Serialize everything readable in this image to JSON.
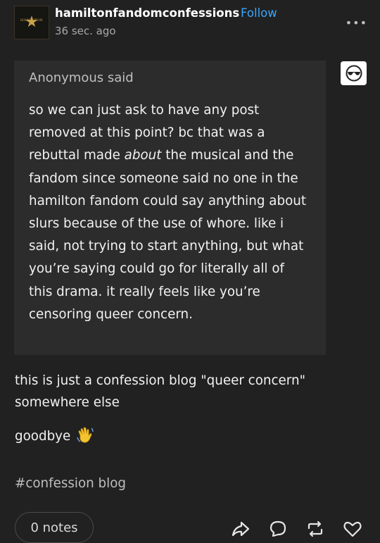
{
  "post": {
    "blog_name": "hamiltonfandomconfessions",
    "follow_label": "Follow",
    "timestamp": "36 sec. ago",
    "avatar_text": "HAMILTON",
    "ask": {
      "asker_name": "Anonymous",
      "asker_suffix": " said",
      "body_before": "so we can just ask to have any post removed at this point? bc that was a rebuttal made ",
      "body_emphasis": "about",
      "body_after": " the musical and the fandom since someone said no one in the hamilton fandom could say anything about slurs because of the use of whore. like i said, not trying to start anything, but what you’re saying could go for literally all of this drama. it really feels like you’re censoring queer concern."
    },
    "answer": "this is just a confession blog \"queer concern\" somewhere else",
    "goodbye": "goodbye",
    "tag": "#confession blog",
    "notes_label": "0 notes"
  },
  "colors": {
    "background": "#212121",
    "ask_background": "#2c2c2c",
    "follow_accent": "#3aa6ff",
    "muted_text": "#a8a8a8",
    "avatar_gold": "#c9a24a"
  },
  "icons": [
    "more-options-icon",
    "anonymous-sunglasses-icon",
    "waving-hand-emoji",
    "share-icon",
    "reply-icon",
    "reblog-icon",
    "like-heart-icon"
  ]
}
